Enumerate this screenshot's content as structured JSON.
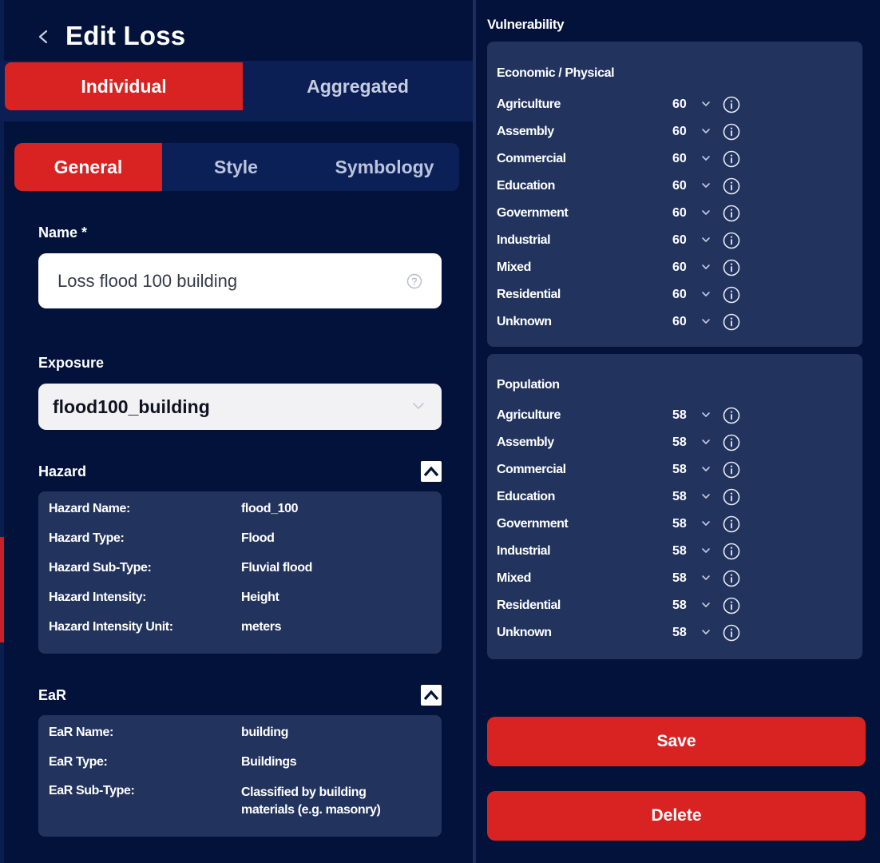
{
  "header": {
    "title": "Edit Loss"
  },
  "main_tabs": [
    {
      "label": "Individual",
      "active": true
    },
    {
      "label": "Aggregated",
      "active": false
    }
  ],
  "sub_tabs": [
    {
      "label": "General",
      "active": true
    },
    {
      "label": "Style",
      "active": false
    },
    {
      "label": "Symbology",
      "active": false
    }
  ],
  "name_field": {
    "label": "Name *",
    "value": "Loss flood 100 building"
  },
  "exposure": {
    "label": "Exposure",
    "selected": "flood100_building"
  },
  "hazard": {
    "title": "Hazard",
    "rows": [
      {
        "key": "Hazard Name:",
        "value": "flood_100"
      },
      {
        "key": "Hazard Type:",
        "value": "Flood"
      },
      {
        "key": "Hazard Sub-Type:",
        "value": "Fluvial flood"
      },
      {
        "key": "Hazard Intensity:",
        "value": "Height"
      },
      {
        "key": "Hazard Intensity Unit:",
        "value": "meters"
      }
    ]
  },
  "ear": {
    "title": "EaR",
    "rows": [
      {
        "key": "EaR Name:",
        "value": "building"
      },
      {
        "key": "EaR Type:",
        "value": "Buildings"
      },
      {
        "key": "EaR Sub-Type:",
        "value": "Classified by building materials (e.g. masonry)"
      }
    ]
  },
  "vulnerability": {
    "title": "Vulnerability",
    "economic": {
      "title": "Economic / Physical",
      "rows": [
        {
          "name": "Agriculture",
          "value": "60"
        },
        {
          "name": "Assembly",
          "value": "60"
        },
        {
          "name": "Commercial",
          "value": "60"
        },
        {
          "name": "Education",
          "value": "60"
        },
        {
          "name": "Government",
          "value": "60"
        },
        {
          "name": "Industrial",
          "value": "60"
        },
        {
          "name": "Mixed",
          "value": "60"
        },
        {
          "name": "Residential",
          "value": "60"
        },
        {
          "name": "Unknown",
          "value": "60"
        }
      ]
    },
    "population": {
      "title": "Population",
      "rows": [
        {
          "name": "Agriculture",
          "value": "58"
        },
        {
          "name": "Assembly",
          "value": "58"
        },
        {
          "name": "Commercial",
          "value": "58"
        },
        {
          "name": "Education",
          "value": "58"
        },
        {
          "name": "Government",
          "value": "58"
        },
        {
          "name": "Industrial",
          "value": "58"
        },
        {
          "name": "Mixed",
          "value": "58"
        },
        {
          "name": "Residential",
          "value": "58"
        },
        {
          "name": "Unknown",
          "value": "58"
        }
      ]
    }
  },
  "actions": {
    "save": "Save",
    "delete": "Delete"
  },
  "colors": {
    "background": "#02123a",
    "card": "#22335e",
    "accent": "#d92323"
  },
  "icons": [
    "chevron-left-icon",
    "help-icon",
    "chevron-down-icon",
    "chevron-up-icon",
    "info-icon"
  ]
}
